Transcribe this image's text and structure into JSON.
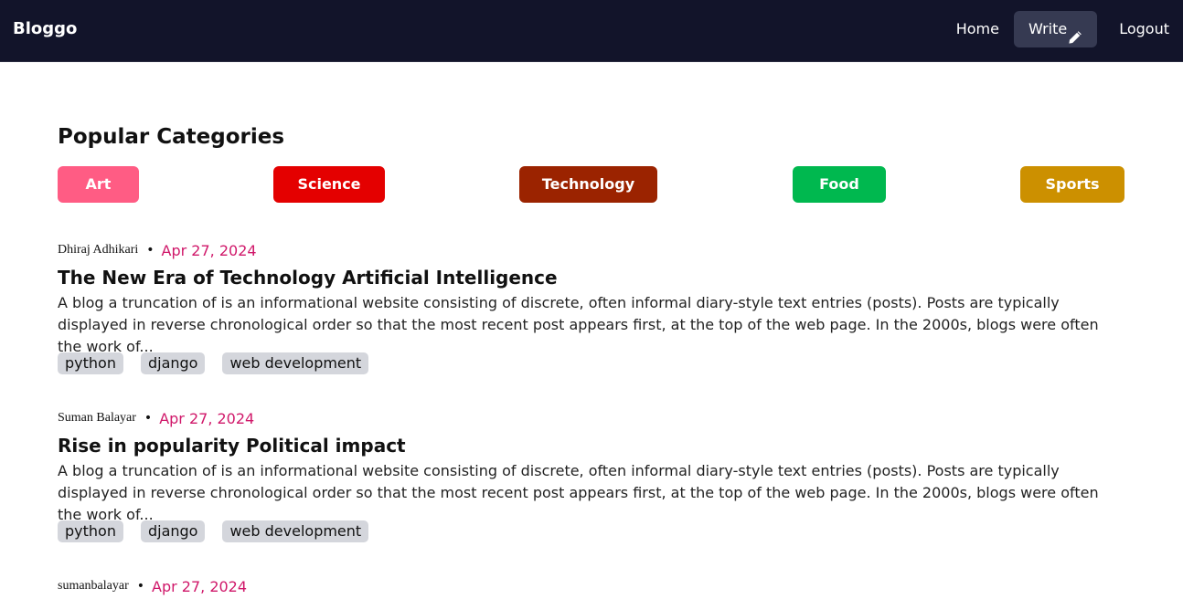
{
  "navbar": {
    "brand": "Bloggo",
    "links": {
      "home": "Home",
      "write": "Write",
      "logout": "Logout"
    },
    "write_icon": "pencil-icon"
  },
  "categories_section": {
    "title": "Popular Categories",
    "categories": [
      {
        "label": "Art",
        "color": "#ff5c84"
      },
      {
        "label": "Science",
        "color": "#e40000"
      },
      {
        "label": "Technology",
        "color": "#9b2300"
      },
      {
        "label": "Food",
        "color": "#00b84f"
      },
      {
        "label": "Sports",
        "color": "#cc9000"
      }
    ]
  },
  "posts": [
    {
      "author": "Dhiraj Adhikari",
      "date": "Apr 27, 2024",
      "title": "The New Era of Technology Artificial Intelligence",
      "excerpt": "A blog a truncation of is an informational website consisting of discrete, often informal diary-style text entries (posts). Posts are typically displayed in reverse chronological order so that the most recent post appears first, at the top of the web page. In the 2000s, blogs were often the work of...",
      "tags": [
        "python",
        "django",
        "web development"
      ]
    },
    {
      "author": "Suman Balayar",
      "date": "Apr 27, 2024",
      "title": "Rise in popularity Political impact",
      "excerpt": "A blog a truncation of is an informational website consisting of discrete, often informal diary-style text entries (posts). Posts are typically displayed in reverse chronological order so that the most recent post appears first, at the top of the web page. In the 2000s, blogs were often the work of...",
      "tags": [
        "python",
        "django",
        "web development"
      ]
    },
    {
      "author": "sumanbalayar",
      "date": "Apr 27, 2024"
    }
  ]
}
